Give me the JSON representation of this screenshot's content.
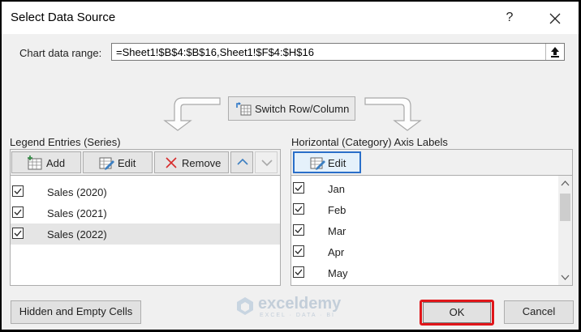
{
  "dialog": {
    "title": "Select Data Source",
    "help_glyph": "?",
    "chart_range_label": "Chart data range:",
    "chart_range_value": "=Sheet1!$B$4:$B$16,Sheet1!$F$4:$H$16",
    "switch_label": "Switch Row/Column"
  },
  "legend": {
    "header": "Legend Entries (Series)",
    "add_label": "Add",
    "edit_label": "Edit",
    "remove_label": "Remove",
    "items": [
      {
        "label": "Sales (2020)",
        "checked": true
      },
      {
        "label": "Sales (2021)",
        "checked": true
      },
      {
        "label": "Sales (2022)",
        "checked": true,
        "selected": true
      }
    ]
  },
  "axis": {
    "header": "Horizontal (Category) Axis Labels",
    "edit_label": "Edit",
    "items": [
      {
        "label": "Jan",
        "checked": true
      },
      {
        "label": "Feb",
        "checked": true
      },
      {
        "label": "Mar",
        "checked": true
      },
      {
        "label": "Apr",
        "checked": true
      },
      {
        "label": "May",
        "checked": true
      }
    ]
  },
  "footer": {
    "hidden_cells_label": "Hidden and Empty Cells",
    "ok_label": "OK",
    "cancel_label": "Cancel"
  },
  "watermark": {
    "brand": "exceldemy",
    "tagline": "EXCEL · DATA · BI"
  },
  "colors": {
    "ok_highlight": "#e0161a",
    "arrow_up": "#3c7fc1",
    "remove_x": "#d72c2c",
    "selected_row": "#e5e5e5"
  }
}
